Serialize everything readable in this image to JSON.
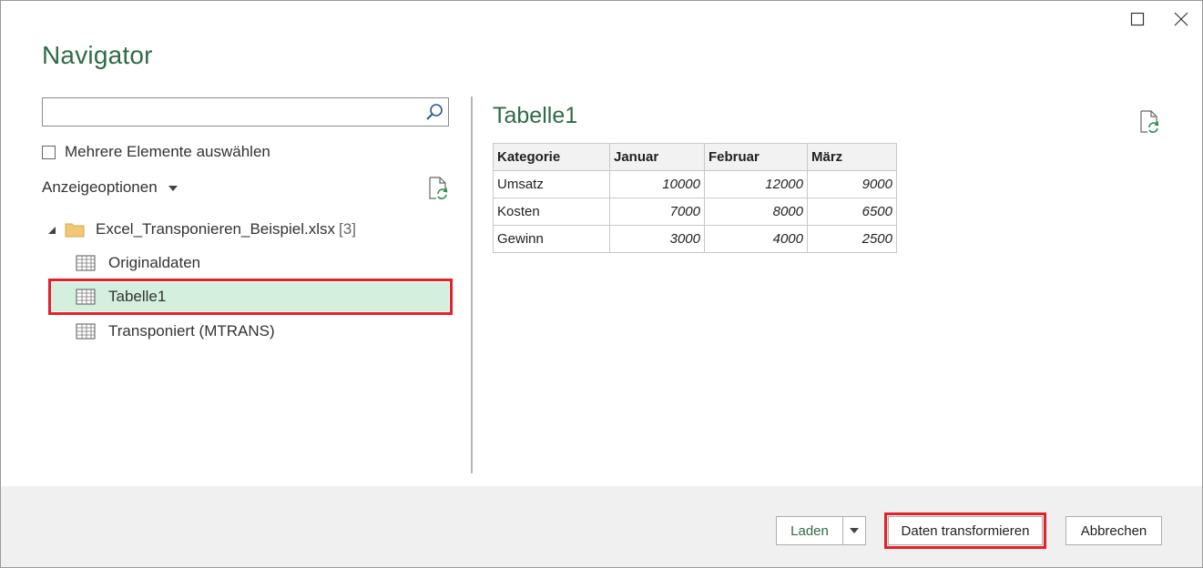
{
  "window": {
    "title": "Navigator"
  },
  "search": {
    "value": "",
    "placeholder": ""
  },
  "multi_select": {
    "label": "Mehrere Elemente auswählen",
    "checked": false
  },
  "display_options": {
    "label": "Anzeigeoptionen"
  },
  "tree": {
    "root": {
      "name": "Excel_Transponieren_Beispiel.xlsx",
      "count": "[3]"
    },
    "items": [
      {
        "label": "Originaldaten",
        "selected": false
      },
      {
        "label": "Tabelle1",
        "selected": true
      },
      {
        "label": "Transponiert (MTRANS)",
        "selected": false
      }
    ]
  },
  "preview": {
    "title": "Tabelle1",
    "headers": [
      "Kategorie",
      "Januar",
      "Februar",
      "März"
    ],
    "rows": [
      [
        "Umsatz",
        "10000",
        "12000",
        "9000"
      ],
      [
        "Kosten",
        "7000",
        "8000",
        "6500"
      ],
      [
        "Gewinn",
        "3000",
        "4000",
        "2500"
      ]
    ]
  },
  "footer": {
    "load_label": "Laden",
    "transform_label": "Daten transformieren",
    "cancel_label": "Abbrechen"
  },
  "colors": {
    "accent": "#2f6b47",
    "selected_bg": "#d5efdf",
    "highlight": "#e32129"
  },
  "icons": [
    "search-icon",
    "refresh-icon",
    "folder-icon",
    "table-icon",
    "maximize-icon",
    "close-icon"
  ]
}
